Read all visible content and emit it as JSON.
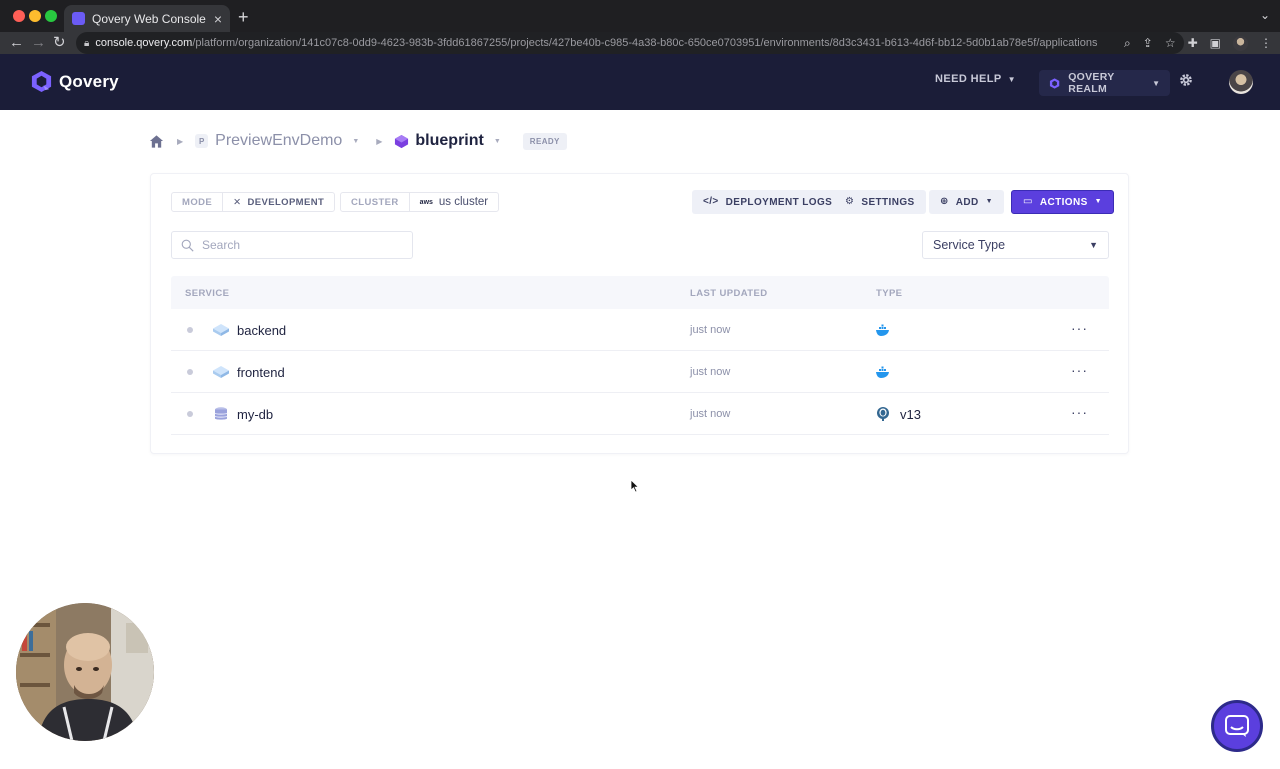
{
  "browser": {
    "tab_title": "Qovery Web Console | The sim",
    "tab_close": "×",
    "new_tab": "+",
    "url_host": "console.qovery.com",
    "url_path": "/platform/organization/141c07c8-0dd9-4623-983b-3fdd61867255/projects/427be40b-c985-4a38-b80c-650ce0703951/environments/8d3c3431-b613-4d6f-bb12-5d0b1ab78e5f/applications"
  },
  "header": {
    "logo_text": "Qovery",
    "need_help": "NEED HELP",
    "realm": "QOVERY REALM"
  },
  "breadcrumb": {
    "project_badge": "P",
    "project": "PreviewEnvDemo",
    "environment": "blueprint",
    "status": "READY"
  },
  "toolbar": {
    "mode_key": "MODE",
    "mode_value": "DEVELOPMENT",
    "cluster_key": "CLUSTER",
    "cluster_provider": "aws",
    "cluster_value": "us cluster",
    "deployment_logs": "DEPLOYMENT LOGS",
    "settings": "SETTINGS",
    "add": "ADD",
    "actions": "ACTIONS"
  },
  "filters": {
    "search_placeholder": "Search",
    "service_type": "Service Type"
  },
  "table": {
    "columns": [
      "SERVICE",
      "LAST UPDATED",
      "TYPE"
    ],
    "rows": [
      {
        "name": "backend",
        "last_updated": "just now",
        "type_icon": "docker-icon",
        "version": ""
      },
      {
        "name": "frontend",
        "last_updated": "just now",
        "type_icon": "docker-icon",
        "version": ""
      },
      {
        "name": "my-db",
        "last_updated": "just now",
        "type_icon": "postgresql-icon",
        "version": "v13"
      }
    ],
    "more": "···"
  },
  "colors": {
    "header_bg": "#1b1d38",
    "primary": "#5b3fde",
    "text": "#1f2340",
    "muted": "#8c90a9"
  }
}
